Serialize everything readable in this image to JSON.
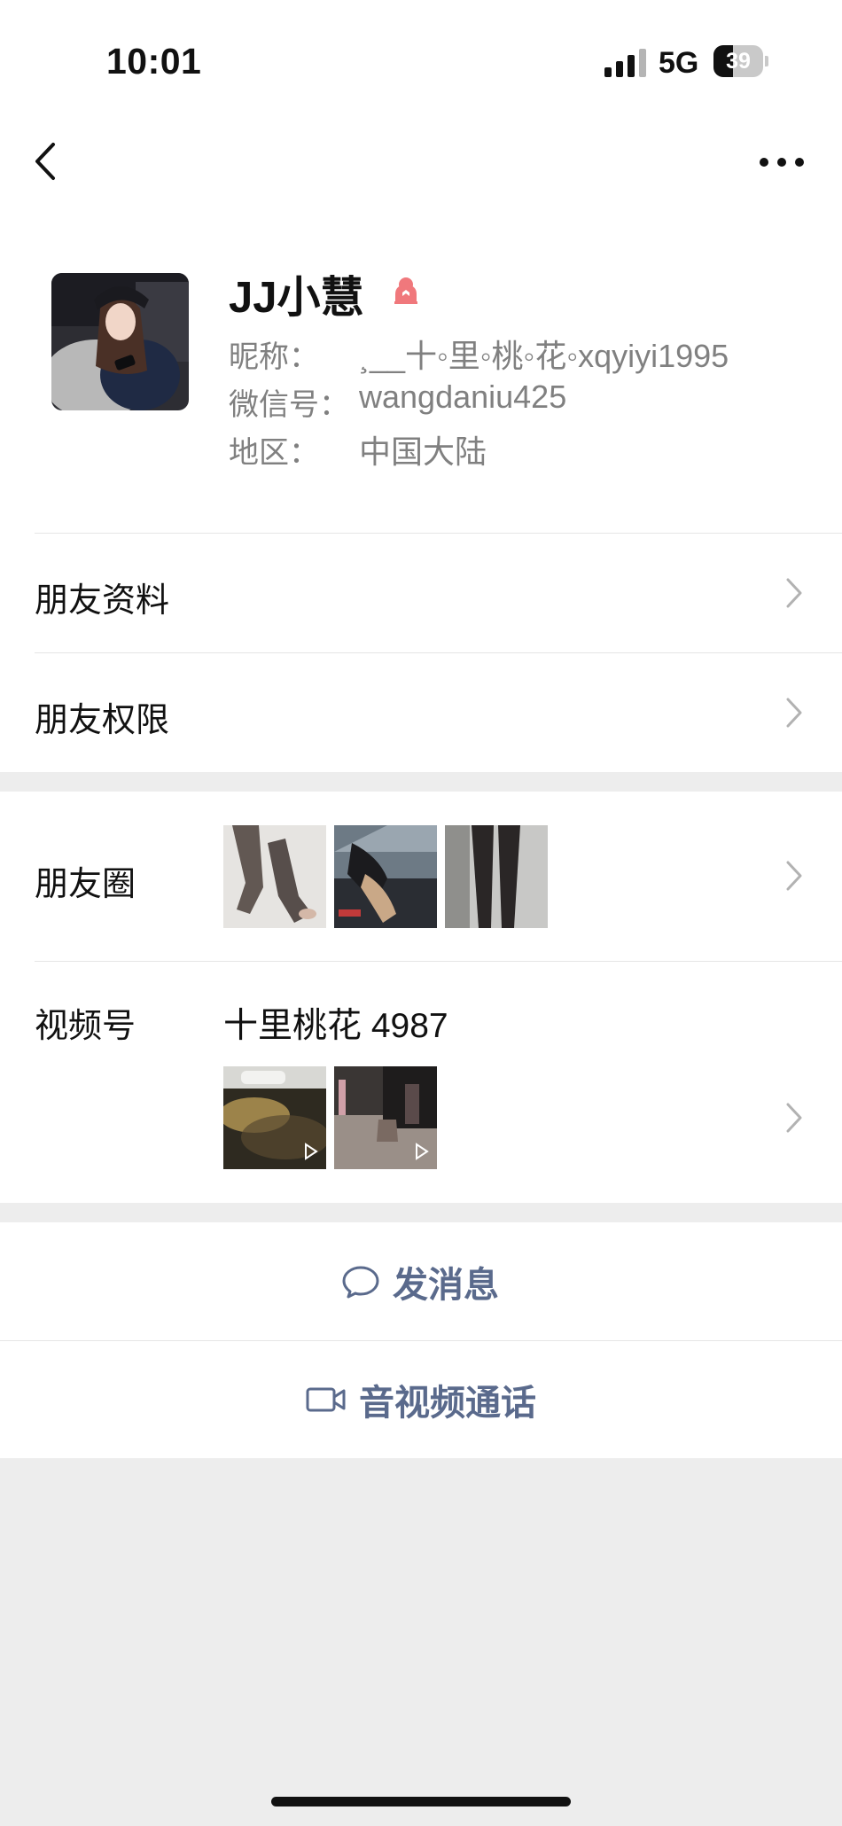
{
  "status_bar": {
    "time": "10:01",
    "network": "5G",
    "battery": "39",
    "battery_level": 0.39
  },
  "nav": {
    "back_icon": "chevron-left-icon",
    "more_icon": "more-dots-icon"
  },
  "profile": {
    "name": "JJ小慧",
    "gender_icon": "female-icon",
    "gender_color": "#f0787c",
    "nickname_label": "昵称：",
    "nickname_value": "¸__十◦里◦桃◦花◦xqyiyi1995",
    "wechat_id_label": "微信号：",
    "wechat_id_value": "wangdaniu425",
    "region_label": "地区：",
    "region_value": "中国大陆"
  },
  "rows": {
    "friend_info": "朋友资料",
    "friend_permissions": "朋友权限",
    "moments": "朋友圈",
    "channels": "视频号",
    "channel_name": "十里桃花 4987"
  },
  "actions": {
    "send_message": "发消息",
    "send_message_icon": "chat-bubble-icon",
    "video_call": "音视频通话",
    "video_call_icon": "video-camera-icon",
    "accent_color": "#5a6a8c"
  }
}
